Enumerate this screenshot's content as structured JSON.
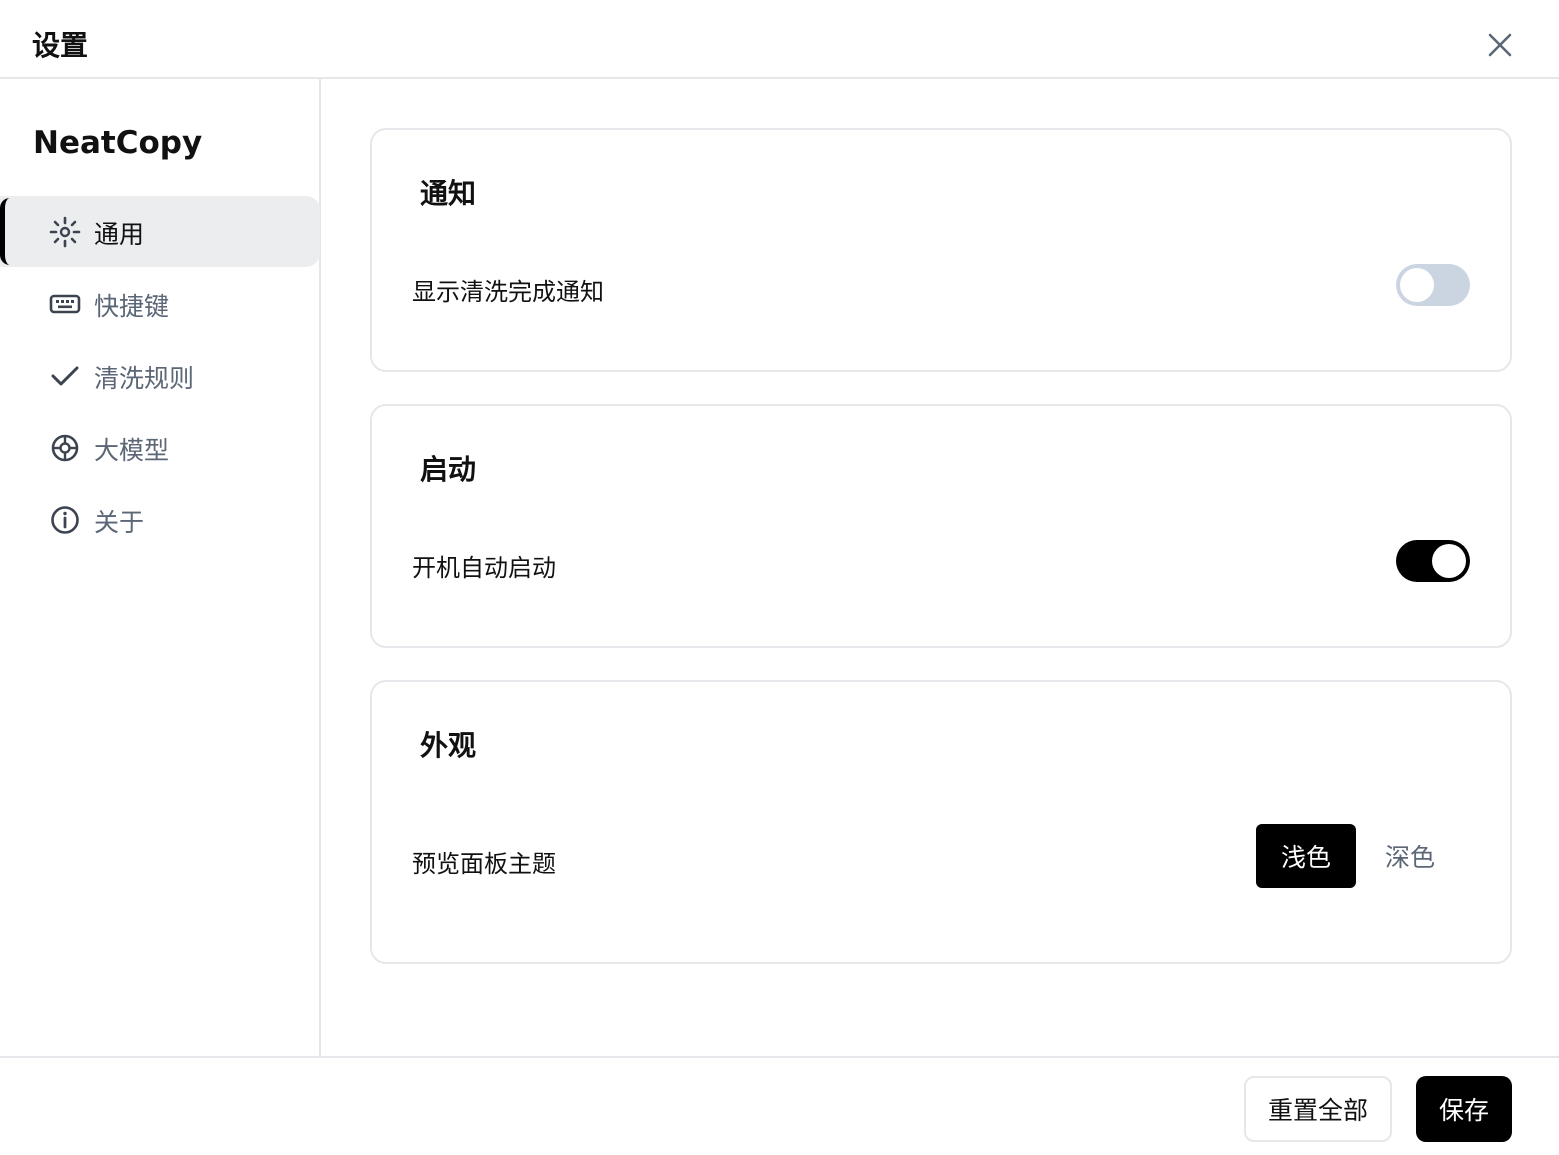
{
  "header": {
    "title": "设置",
    "close_icon": "close-icon"
  },
  "sidebar": {
    "brand": "NeatCopy",
    "items": [
      {
        "label": "通用",
        "icon": "gear-icon",
        "active": true
      },
      {
        "label": "快捷键",
        "icon": "keyboard-icon",
        "active": false
      },
      {
        "label": "清洗规则",
        "icon": "check-icon",
        "active": false
      },
      {
        "label": "大模型",
        "icon": "aperture-icon",
        "active": false
      },
      {
        "label": "关于",
        "icon": "info-icon",
        "active": false
      }
    ]
  },
  "sections": {
    "notification": {
      "title": "通知",
      "rows": [
        {
          "label": "显示清洗完成通知",
          "enabled": false
        }
      ]
    },
    "startup": {
      "title": "启动",
      "rows": [
        {
          "label": "开机自动启动",
          "enabled": true
        }
      ]
    },
    "appearance": {
      "title": "外观",
      "rows": [
        {
          "label": "预览面板主题",
          "options": [
            "浅色",
            "深色"
          ],
          "selected": "浅色"
        }
      ]
    }
  },
  "footer": {
    "reset_label": "重置全部",
    "save_label": "保存"
  },
  "colors": {
    "accent": "#000000",
    "muted_text": "#5b6676",
    "toggle_off": "#cbd5e1",
    "border": "#e6e7ea",
    "active_nav_bg": "#ebedef"
  }
}
